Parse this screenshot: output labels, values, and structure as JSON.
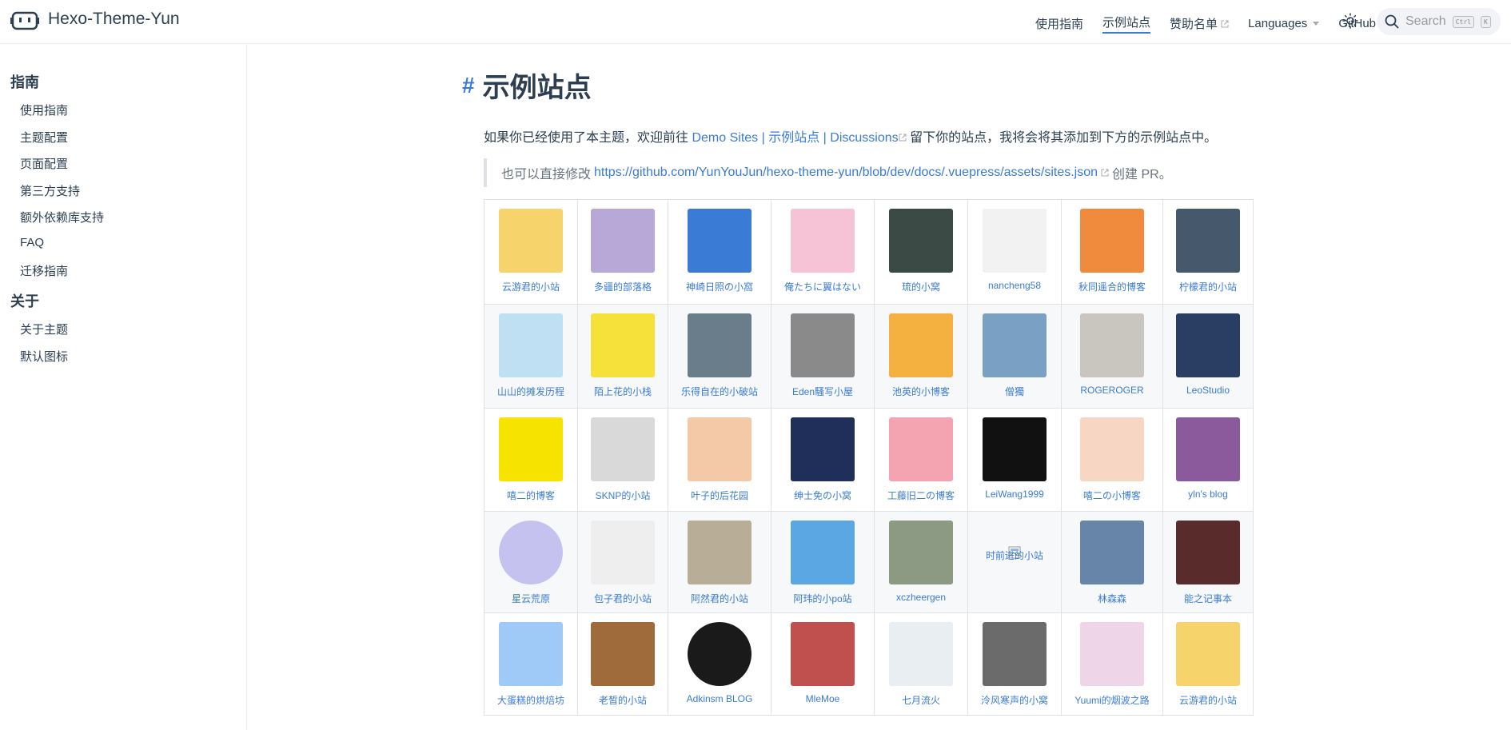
{
  "navbar": {
    "site_name": "Hexo-Theme-Yun",
    "links": [
      {
        "label": "使用指南",
        "external": false,
        "active": false
      },
      {
        "label": "示例站点",
        "external": false,
        "active": true
      },
      {
        "label": "赞助名单",
        "external": true,
        "active": false
      },
      {
        "label": "Languages",
        "dropdown": true,
        "active": false
      },
      {
        "label": "GitHub",
        "external": true,
        "active": false
      }
    ],
    "search_placeholder": "Search",
    "kbd_ctrl": "Ctrl",
    "kbd_k": "K"
  },
  "sidebar": {
    "groups": [
      {
        "heading": "指南",
        "items": [
          "使用指南",
          "主题配置",
          "页面配置",
          "第三方支持",
          "额外依赖库支持",
          "FAQ",
          "迁移指南"
        ]
      },
      {
        "heading": "关于",
        "items": [
          "关于主题",
          "默认图标"
        ]
      }
    ]
  },
  "content": {
    "hash": "#",
    "title": "示例站点",
    "intro_before": "如果你已经使用了本主题，欢迎前往",
    "intro_link": "Demo Sites | 示例站点 | Discussions",
    "intro_after": "留下你的站点，我将会将其添加到下方的示例站点中。",
    "tip_before": "也可以直接修改",
    "tip_link": "https://github.com/YunYouJun/hexo-theme-yun/blob/dev/docs/.vuepress/assets/sites.json",
    "tip_after": "创建 PR。"
  },
  "colors": {
    "accent": "#3a7bd5",
    "text": "#2c3e50",
    "border": "#dfe2e5"
  },
  "sites": [
    [
      {
        "name": "云游君的小站",
        "color": "#f6d36b"
      },
      {
        "name": "多疆的部落格",
        "color": "#b7a8d8"
      },
      {
        "name": "神崎日照の小窩",
        "color": "#3a7bd5"
      },
      {
        "name": "俺たちに翼はない",
        "color": "#f5c3d5"
      },
      {
        "name": "琉的小窝",
        "color": "#3b4a45"
      },
      {
        "name": "nancheng58",
        "color": "#f2f2f2"
      },
      {
        "name": "秋同遥合的博客",
        "color": "#f08a3c"
      },
      {
        "name": "柠檬君的小站",
        "color": "#46586b"
      }
    ],
    [
      {
        "name": "山山的摊发历程",
        "color": "#bfe0f3"
      },
      {
        "name": "陌上花的小栈",
        "color": "#f6e13a"
      },
      {
        "name": "乐得自在的小破站",
        "color": "#6a7d8a"
      },
      {
        "name": "Eden騷写小屋",
        "color": "#8a8a8a"
      },
      {
        "name": "池英的小博客",
        "color": "#f4b13f"
      },
      {
        "name": "僧獨",
        "color": "#7aa0c4"
      },
      {
        "name": "ROGEROGER",
        "color": "#c9c6bf"
      },
      {
        "name": "LeoStudio",
        "color": "#2a3d63"
      }
    ],
    [
      {
        "name": "嘻二的博客",
        "color": "#f7e300"
      },
      {
        "name": "SKNP的小站",
        "color": "#d9d9d9"
      },
      {
        "name": "叶子的后花园",
        "color": "#f3c9a8"
      },
      {
        "name": "绅士免の小窝",
        "color": "#1f2f5a"
      },
      {
        "name": "工藤旧二の博客",
        "color": "#f3a4b0"
      },
      {
        "name": "LeiWang1999",
        "color": "#111111"
      },
      {
        "name": "嘻二の小博客",
        "color": "#f7d7c4"
      },
      {
        "name": "yln's blog",
        "color": "#8a5a9c"
      }
    ],
    [
      {
        "name": "星云荒原",
        "color": "#c6c2ef",
        "round": true
      },
      {
        "name": "包子君的小站",
        "color": "#eeeeee"
      },
      {
        "name": "阿然君的小站",
        "color": "#b8ad96"
      },
      {
        "name": "阿玮的小po站",
        "color": "#5aa7e3"
      },
      {
        "name": "xczheergen",
        "color": "#8c9a83"
      },
      {
        "name": "时前进的小站",
        "color": "",
        "broken": true
      },
      {
        "name": "林森森",
        "color": "#6785a8"
      },
      {
        "name": "能之记事本",
        "color": "#5a2b2b"
      }
    ],
    [
      {
        "name": "大蛋糕的烘焙坊",
        "color": "#9fcaf7"
      },
      {
        "name": "老皙的小站",
        "color": "#a06b3a"
      },
      {
        "name": "Adkinsm BLOG",
        "color": "#1a1a1a",
        "round": true
      },
      {
        "name": "MleMoe",
        "color": "#c0504d"
      },
      {
        "name": "七月流火",
        "color": "#e9eef2"
      },
      {
        "name": "泠风寒声的小窝",
        "color": "#6b6b6b"
      },
      {
        "name": "Yuumi的烟波之路",
        "color": "#eed5e8"
      },
      {
        "name": "云游君的小站",
        "color": "#f6d36b"
      }
    ]
  ]
}
